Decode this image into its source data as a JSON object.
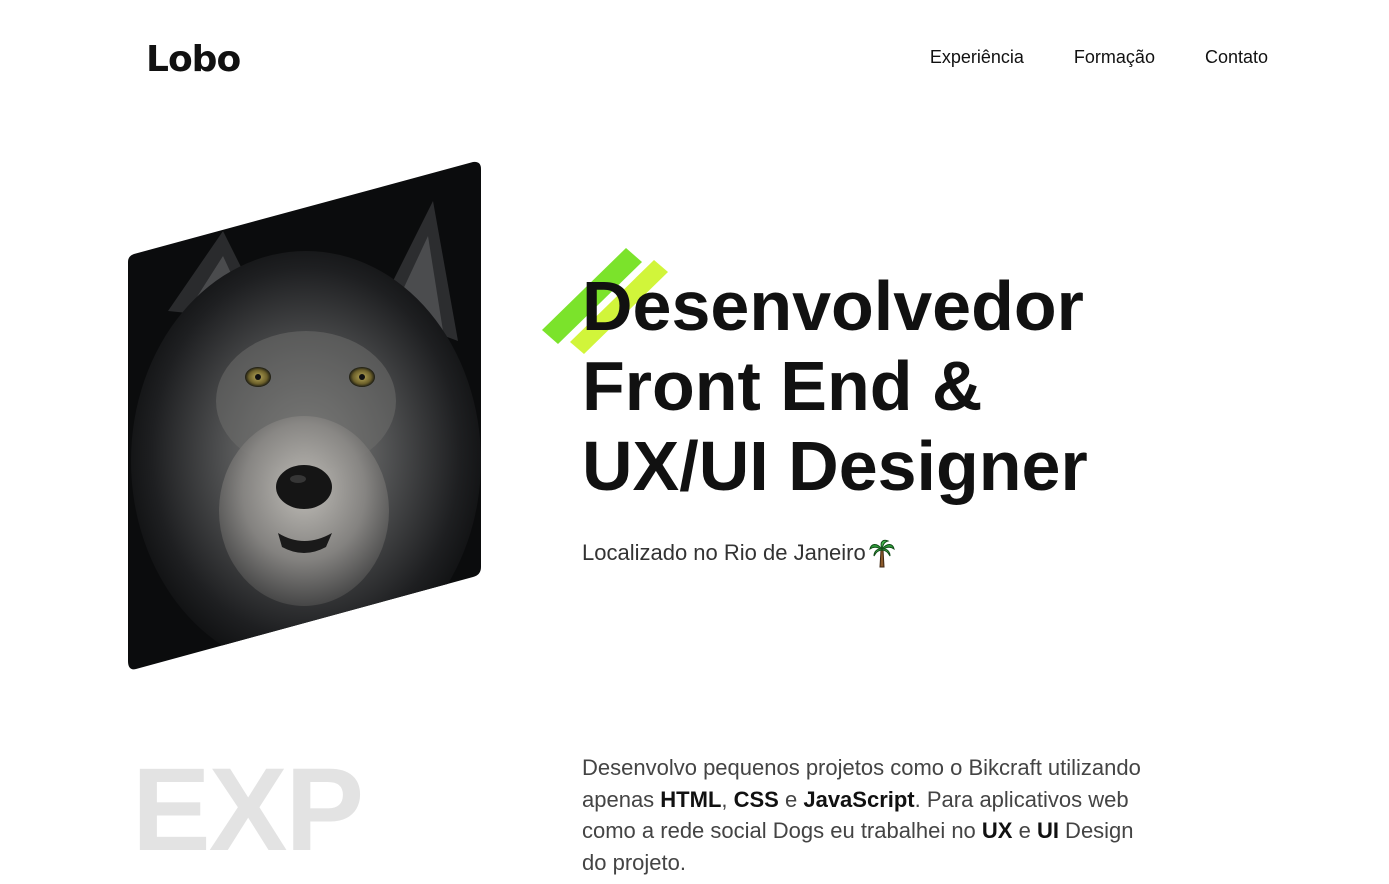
{
  "header": {
    "logo": "Lobo",
    "nav": [
      {
        "label": "Experiência"
      },
      {
        "label": "Formação"
      },
      {
        "label": "Contato"
      }
    ]
  },
  "hero": {
    "image_alt": "wolf-portrait",
    "headline_lines": [
      "Desenvolvedor",
      "Front End &",
      "UX/UI Designer"
    ],
    "location": "Localizado no Rio de Janeiro",
    "location_icon": "palm-tree-icon",
    "accent_colors": [
      "#7be32b",
      "#d1f53a"
    ]
  },
  "experience": {
    "ghost_title": "EXP",
    "about": {
      "part1": "Desenvolvo pequenos projetos como o Bikcraft utilizando apenas ",
      "html": "HTML",
      "sep1": ", ",
      "css": "CSS",
      "sep2": " e ",
      "js": "JavaScript",
      "part2": ". Para aplicativos web como a rede social Dogs eu trabalhei no ",
      "ux": "UX",
      "sep3": " e ",
      "ui": "UI",
      "part3": " Design do projeto."
    }
  }
}
